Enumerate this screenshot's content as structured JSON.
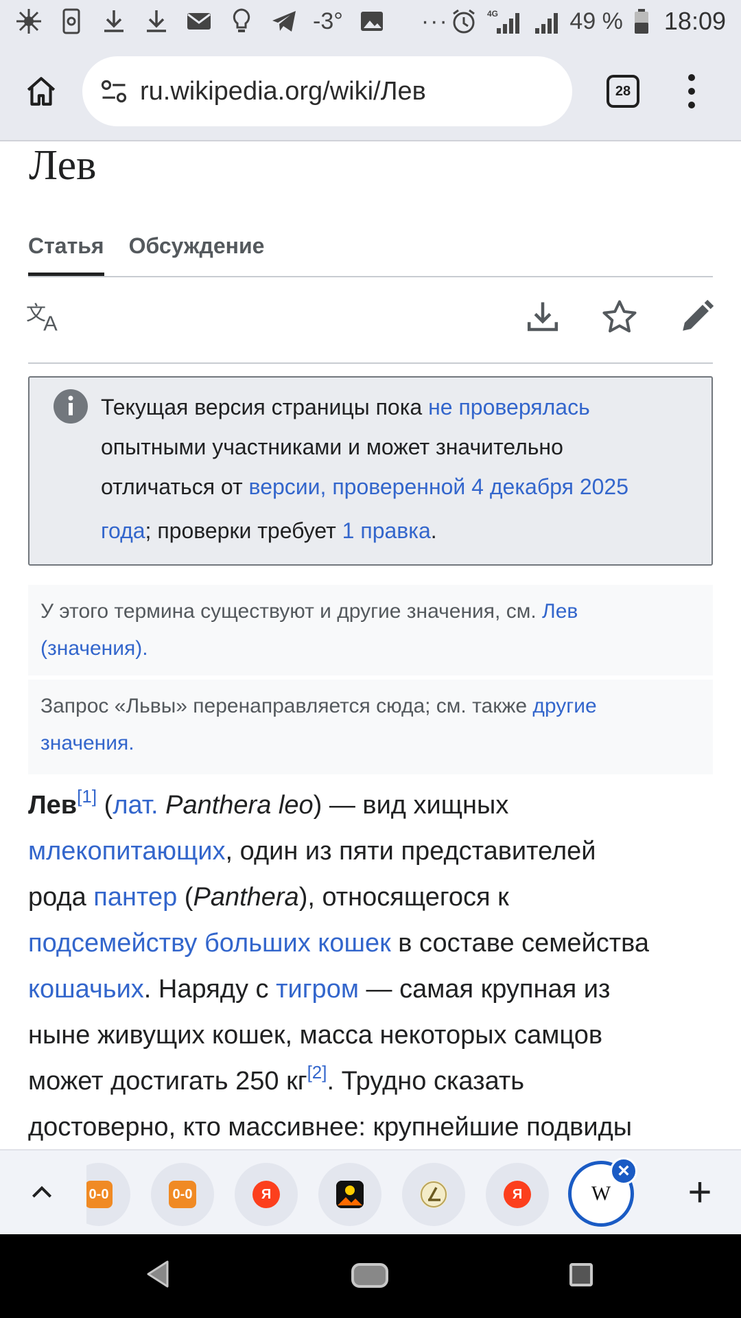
{
  "status_bar": {
    "temperature": "-3°",
    "more": "···",
    "network": "4G",
    "battery": "49 %",
    "time": "18:09"
  },
  "browser": {
    "url": "ru.wikipedia.org/wiki/Лев",
    "tab_count": "28"
  },
  "page": {
    "title": "Лев",
    "tabs": [
      {
        "label": "Статья",
        "active": true
      },
      {
        "label": "Обсуждение",
        "active": false
      }
    ]
  },
  "notice": {
    "t1": "Текущая версия страницы пока ",
    "l1": "не проверялась",
    "t2": "опытными участниками и может значительно",
    "t3": "отличаться от ",
    "l2": "версии, проверенной 4 декабря 2025",
    "l3": "года",
    "t4": "; проверки требует ",
    "l4": "1 правка",
    "t5": "."
  },
  "hatnotes": {
    "h1_text": "У этого термина существуют и другие значения, см. ",
    "h1_link_a": "Лев",
    "h1_link_b": "(значения)",
    "h1_end": ".",
    "h2_text": "Запрос «Львы» перенаправляется сюда; см. также ",
    "h2_link_a": "другие",
    "h2_link_b": "значения",
    "h2_end": "."
  },
  "article": {
    "bold": "Лев",
    "ref1": "[1]",
    "a1": " (",
    "lat": "лат.",
    "a2": " ",
    "latname": "Panthera leo",
    "a3": ") — вид хищных",
    "l_mammals": "млекопитающих",
    "a4": ", один из пяти представителей",
    "a5": "рода ",
    "l_panthers": "пантер",
    "a6": " (",
    "genus": "Panthera",
    "a7": "), относящегося к",
    "l_subfamily": "подсемейству больших кошек",
    "a8": " в составе семейства",
    "l_felids": "кошачьих",
    "a9": ". Наряду с ",
    "l_tiger": "тигром",
    "a10": " — самая крупная из",
    "a11": "ныне живущих кошек, масса некоторых самцов",
    "a12": "может достигать 250 кг",
    "ref2": "[2]",
    "a13": ". Трудно сказать",
    "a14": "достоверно, кто массивнее: крупнейшие подвиды"
  },
  "tab_strip": {
    "tabs": [
      {
        "icon": "counter-favicon-icon",
        "label": "0-0"
      },
      {
        "icon": "counter-favicon-icon",
        "label": "0-0"
      },
      {
        "icon": "yandex-icon",
        "label": "Я"
      },
      {
        "icon": "gallery-icon",
        "label": ""
      },
      {
        "icon": "lingualeo-icon",
        "label": ""
      },
      {
        "icon": "yandex-icon",
        "label": "Я"
      },
      {
        "icon": "wikipedia-icon",
        "label": "W",
        "active": true
      }
    ],
    "colors": {
      "active": "#1a5bc4",
      "yandex": "#fc3f1d",
      "counter": "#f08a24"
    }
  }
}
